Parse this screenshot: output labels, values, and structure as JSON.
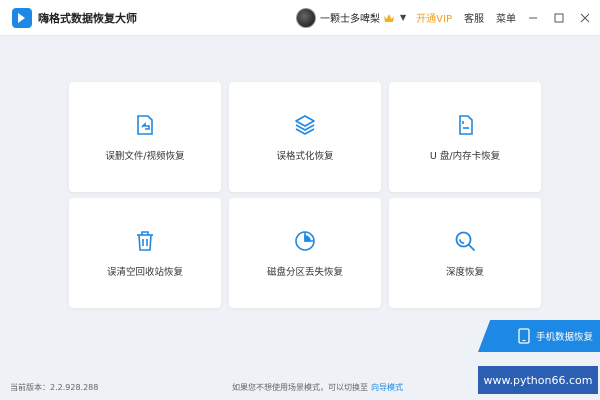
{
  "window": {
    "title": "嗨格式数据恢复大师",
    "user_name": "一颗士多啤梨",
    "vip_label": "开通VIP",
    "service_label": "客服",
    "menu_label": "菜单"
  },
  "cards": [
    {
      "label": "误删文件/视频恢复",
      "icon": "file-restore-icon"
    },
    {
      "label": "误格式化恢复",
      "icon": "layers-icon"
    },
    {
      "label": "U 盘/内存卡恢复",
      "icon": "sd-card-icon"
    },
    {
      "label": "误清空回收站恢复",
      "icon": "trash-icon"
    },
    {
      "label": "磁盘分区丢失恢复",
      "icon": "pie-chart-icon"
    },
    {
      "label": "深度恢复",
      "icon": "search-icon"
    }
  ],
  "mobile_tab": {
    "label": "手机数据恢复"
  },
  "footer": {
    "version": "当前版本：2.2.928.288",
    "hint": "如果您不想使用场景模式，可以切换至",
    "guide_link": "向导模式"
  },
  "watermark": "www.python66.com",
  "colors": {
    "accent": "#1e88e5",
    "vip": "#f0a020",
    "background": "#eef1f5"
  }
}
